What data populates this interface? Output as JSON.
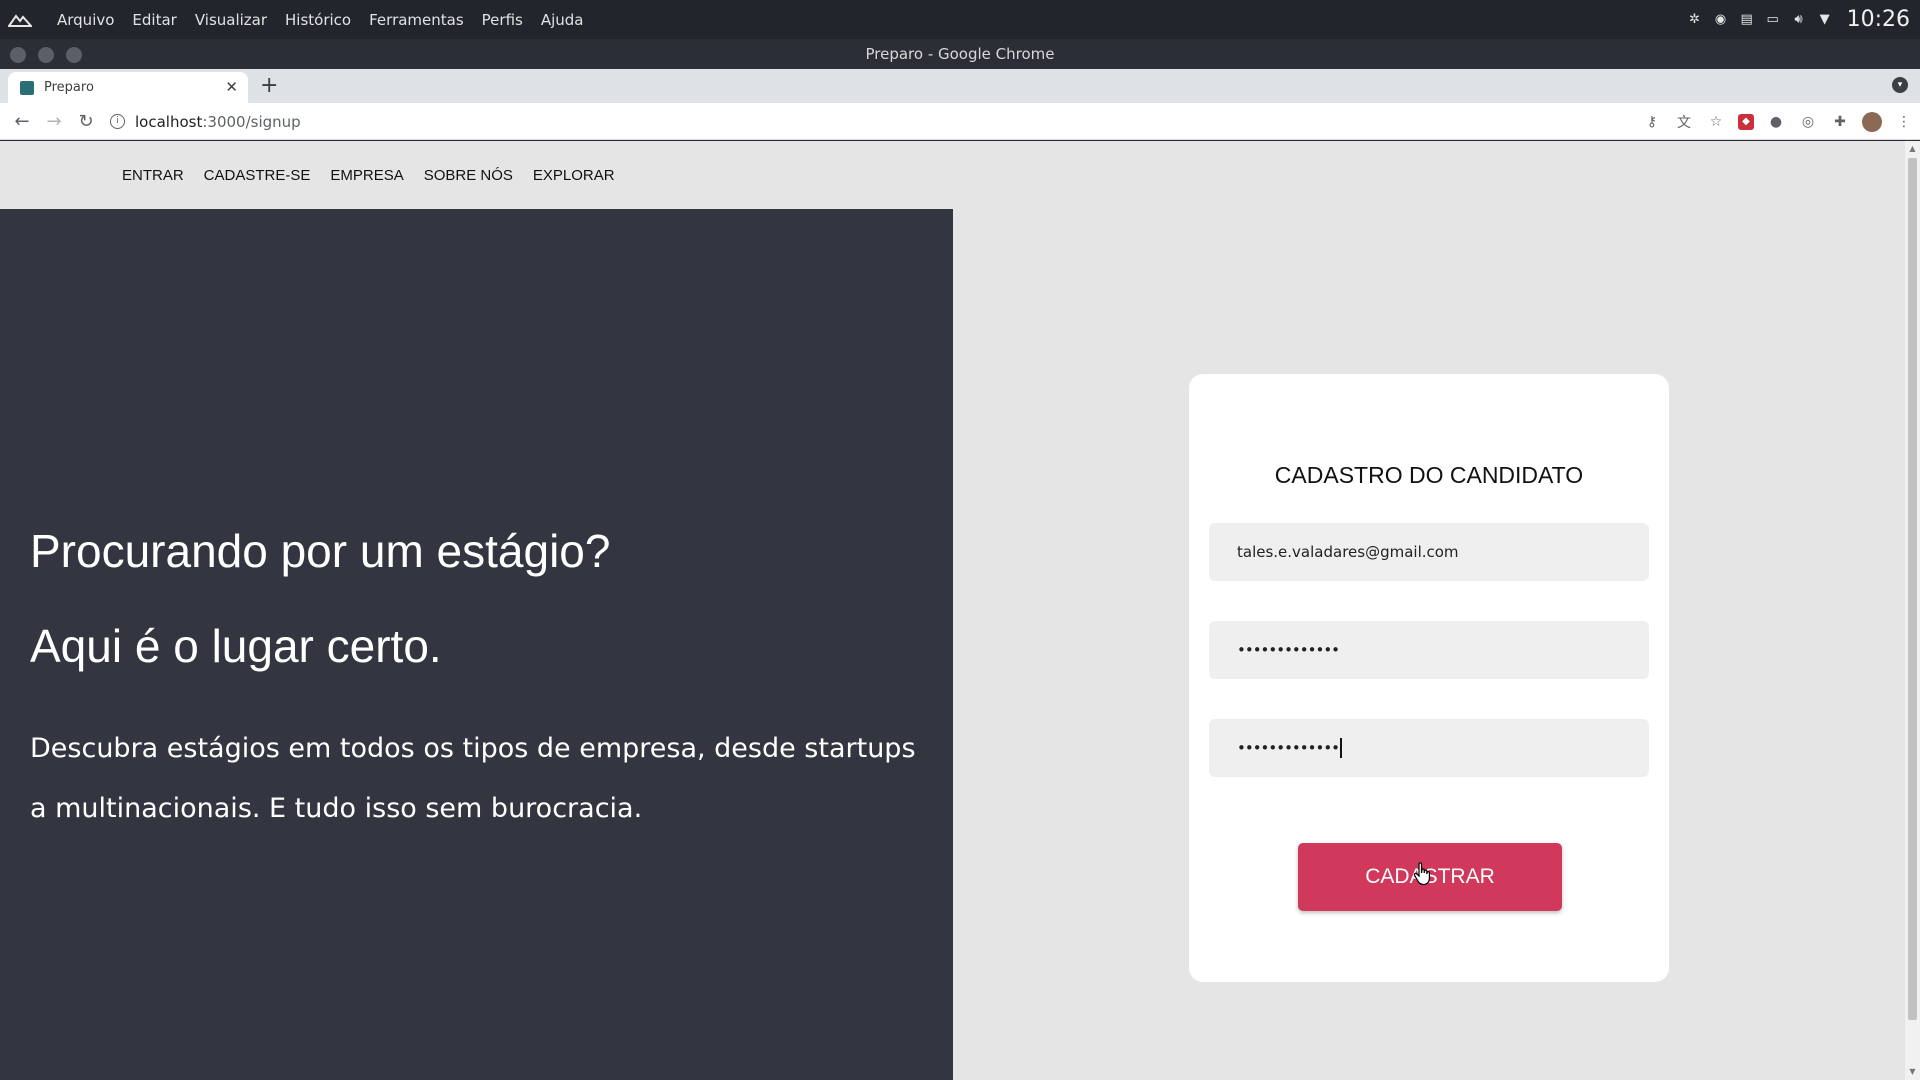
{
  "os": {
    "menu": [
      "Arquivo",
      "Editar",
      "Visualizar",
      "Histórico",
      "Ferramentas",
      "Perfis",
      "Ajuda"
    ],
    "clock": "10:26"
  },
  "window": {
    "title": "Preparo - Google Chrome"
  },
  "browser": {
    "tab_title": "Preparo",
    "url_host": "localhost",
    "url_path": ":3000/signup"
  },
  "site": {
    "nav": [
      "ENTRAR",
      "CADASTRE-SE",
      "EMPRESA",
      "SOBRE NÓS",
      "EXPLORAR"
    ],
    "hero_title": "Procurando por um estágio?",
    "hero_subtitle": "Aqui é o lugar certo.",
    "hero_text": "Descubra estágios em todos os tipos de empresa, desde startups a multinacionais. E tudo isso sem burocracia."
  },
  "form": {
    "title": "CADASTRO DO CANDIDATO",
    "email_value": "tales.e.valadares@gmail.com",
    "password_mask": "•••••••••••••",
    "confirm_mask": "•••••••••••••",
    "submit_label": "CADASTRAR"
  },
  "colors": {
    "hero_bg": "#333640",
    "submit_bg": "#d0385c",
    "page_bg": "#e5e5e5"
  }
}
